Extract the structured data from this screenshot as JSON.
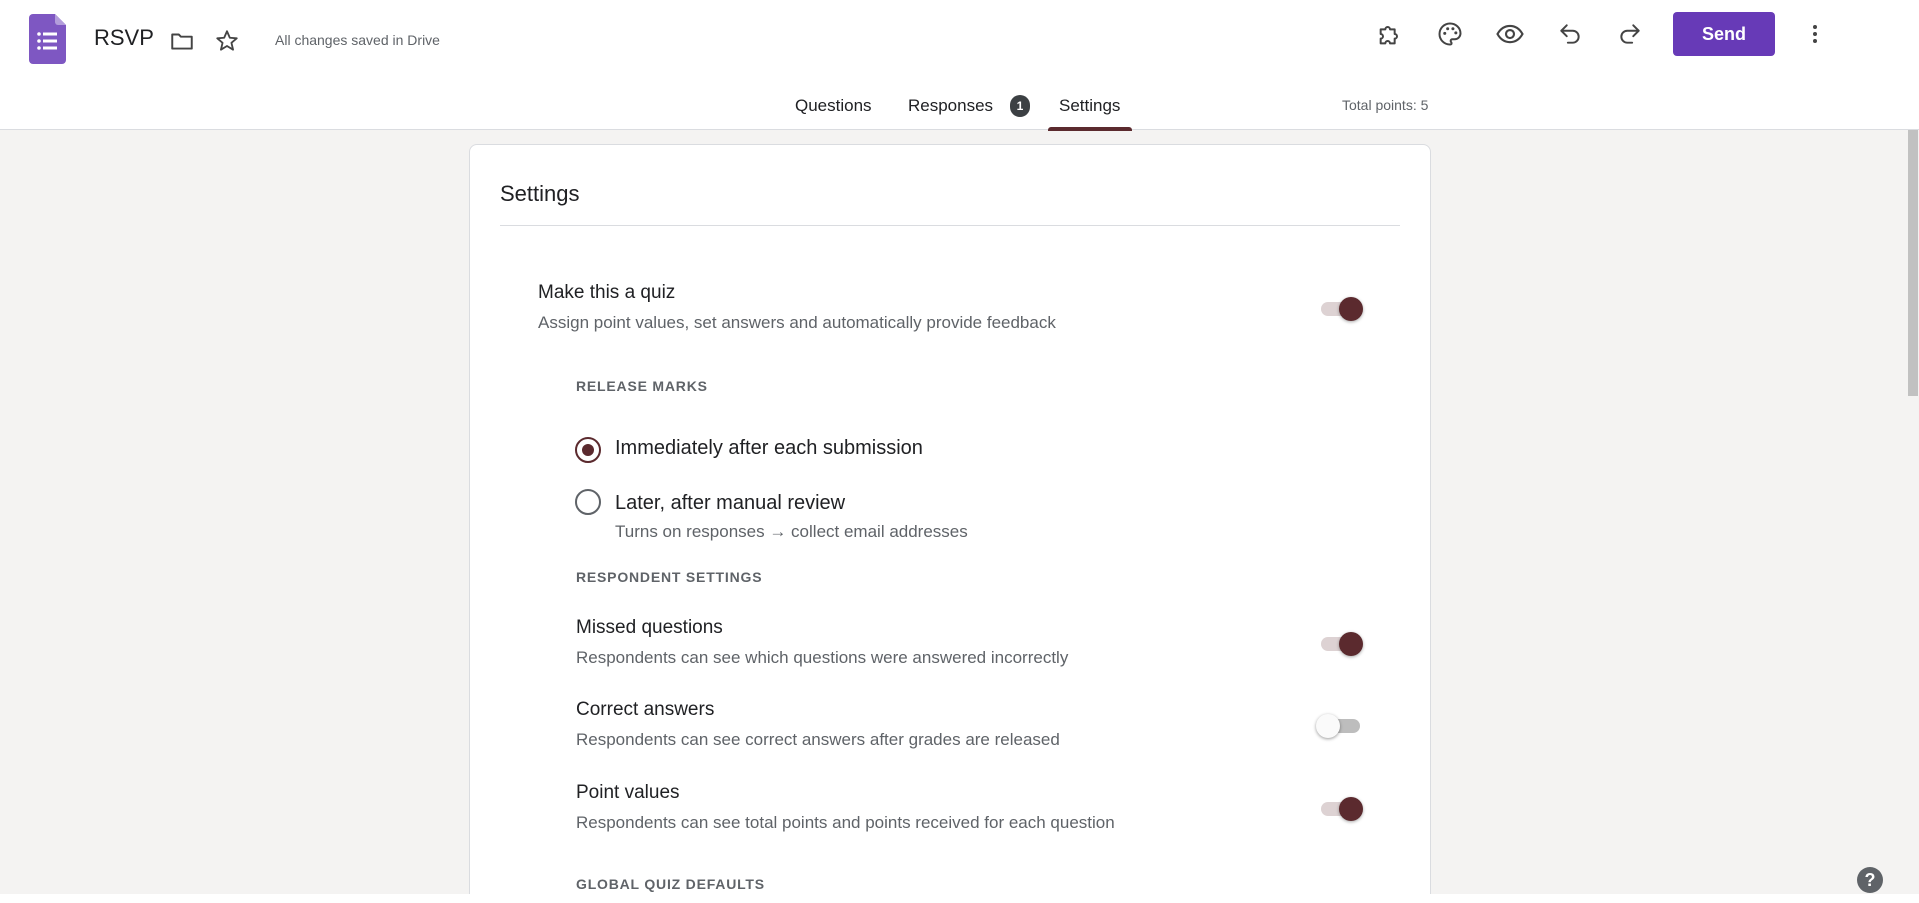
{
  "app": {
    "doc_title": "RSVP",
    "save_status": "All changes saved in Drive",
    "send_label": "Send",
    "accent_color": "#673ab7",
    "theme_color": "#5b2a2e"
  },
  "header_icons": [
    "forms-logo-icon",
    "folder-icon",
    "star-icon",
    "puzzle-icon",
    "palette-icon",
    "eye-icon",
    "undo-icon",
    "redo-icon",
    "more-vert-icon"
  ],
  "tabs": [
    {
      "label": "Questions",
      "active": false
    },
    {
      "label": "Responses",
      "active": false,
      "badge": "1"
    },
    {
      "label": "Settings",
      "active": true
    }
  ],
  "total_points": "Total points: 5",
  "settings": {
    "title": "Settings",
    "quiz": {
      "title": "Make this a quiz",
      "desc": "Assign point values, set answers and automatically provide feedback",
      "on": true
    },
    "release_marks": {
      "label": "RELEASE MARKS",
      "options": [
        {
          "label": "Immediately after each submission",
          "checked": true
        },
        {
          "label": "Later, after manual review",
          "checked": false,
          "hint": "Turns on responses → collect email addresses"
        }
      ]
    },
    "respondent": {
      "label": "RESPONDENT SETTINGS",
      "items": [
        {
          "title": "Missed questions",
          "desc": "Respondents can see which questions were answered incorrectly",
          "on": true
        },
        {
          "title": "Correct answers",
          "desc": "Respondents can see correct answers after grades are released",
          "on": false
        },
        {
          "title": "Point values",
          "desc": "Respondents can see total points and points received for each question",
          "on": true
        }
      ]
    },
    "global_defaults": {
      "label": "GLOBAL QUIZ DEFAULTS"
    }
  },
  "help_label": "?"
}
